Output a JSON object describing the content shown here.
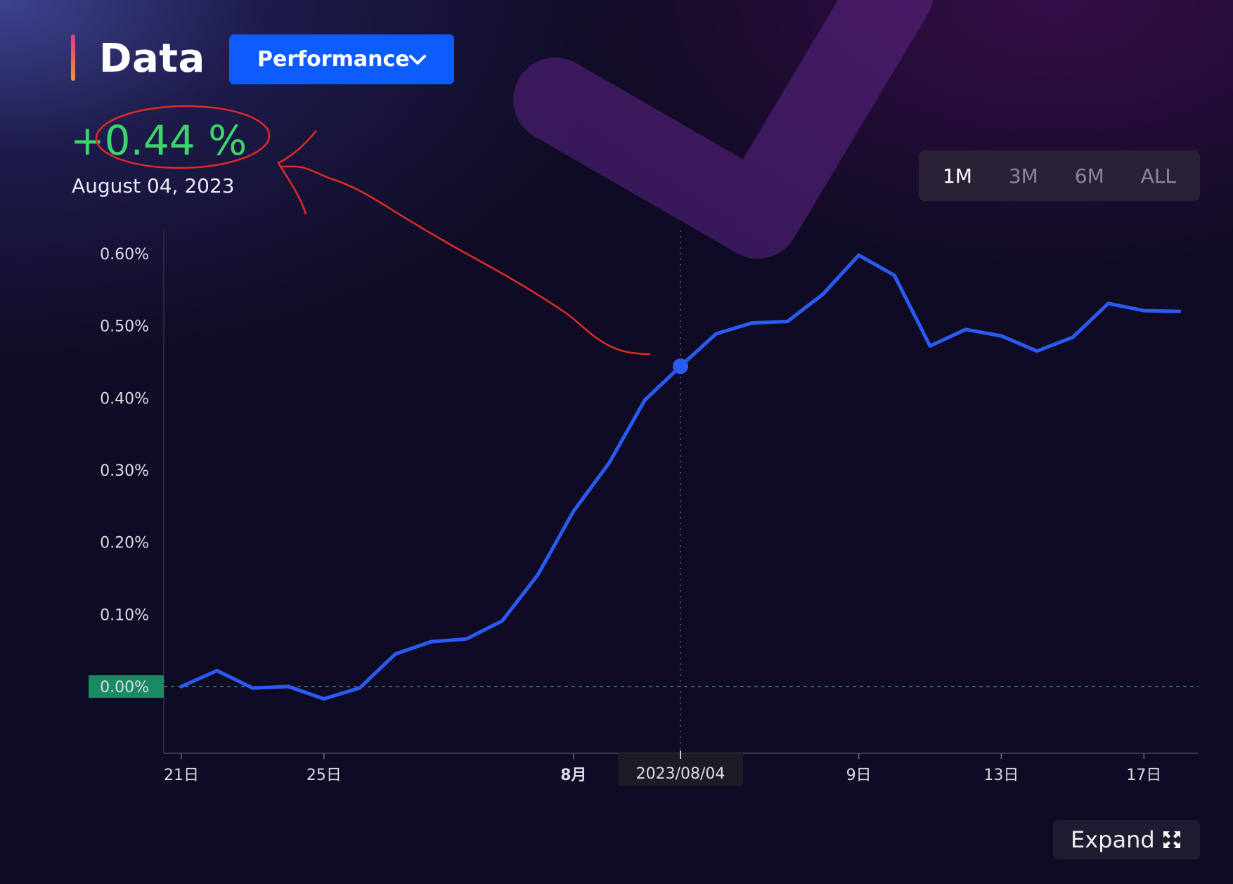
{
  "header": {
    "title": "Data",
    "dropdown_label": "Performance",
    "performance_value": "+0.44 %",
    "performance_date": "August 04, 2023",
    "accent_color": "#0c5cff",
    "positive_color": "#3bd66c"
  },
  "range_tabs": [
    {
      "label": "1M",
      "active": true
    },
    {
      "label": "3M",
      "active": false
    },
    {
      "label": "6M",
      "active": false
    },
    {
      "label": "ALL",
      "active": false
    }
  ],
  "expand_button": {
    "label": "Expand",
    "icon": "expand-arrows-icon"
  },
  "chart_data": {
    "type": "line",
    "x_ticks": [
      "21日",
      "25日",
      "8月",
      "9日",
      "13日",
      "17日"
    ],
    "crosshair_label": "2023/08/04",
    "y_ticks": [
      "0.60%",
      "0.50%",
      "0.40%",
      "0.30%",
      "0.20%",
      "0.10%",
      "0.00%"
    ],
    "y_tick_values": [
      0.6,
      0.5,
      0.4,
      0.3,
      0.2,
      0.1,
      0.0
    ],
    "ylim": [
      -0.09,
      0.63
    ],
    "x_dates": [
      "2023-07-21",
      "2023-07-22",
      "2023-07-23",
      "2023-07-24",
      "2023-07-25",
      "2023-07-26",
      "2023-07-27",
      "2023-07-28",
      "2023-07-29",
      "2023-07-30",
      "2023-07-31",
      "2023-08-01",
      "2023-08-02",
      "2023-08-03",
      "2023-08-04",
      "2023-08-05",
      "2023-08-06",
      "2023-08-07",
      "2023-08-08",
      "2023-08-09",
      "2023-08-10",
      "2023-08-11",
      "2023-08-12",
      "2023-08-13",
      "2023-08-14",
      "2023-08-15",
      "2023-08-16",
      "2023-08-17",
      "2023-08-18"
    ],
    "series": [
      {
        "color": "#2a5cf5",
        "values": [
          0.0,
          0.022,
          -0.002,
          0.0,
          -0.017,
          -0.002,
          0.045,
          0.062,
          0.066,
          0.091,
          0.155,
          0.243,
          0.31,
          0.397,
          0.444,
          0.489,
          0.504,
          0.506,
          0.544,
          0.598,
          0.57,
          0.472,
          0.495,
          0.486,
          0.465,
          0.484,
          0.531,
          0.521,
          0.52
        ]
      }
    ],
    "highlight_date": "2023-08-04",
    "highlight_value": 0.444,
    "baseline_value": 0.0,
    "baseline_color": "#1a8a62",
    "grid": false
  }
}
